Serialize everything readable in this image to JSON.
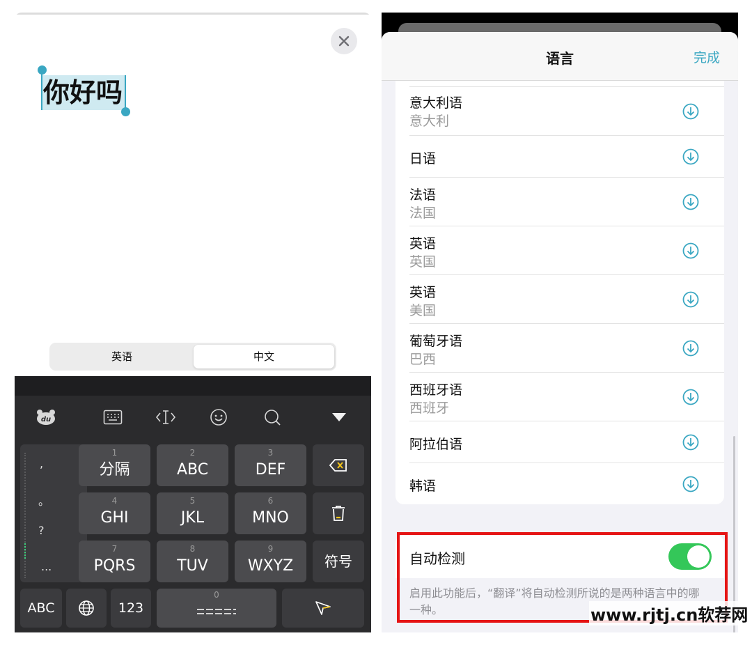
{
  "left": {
    "selected_text": "你好吗",
    "segment": {
      "left_label": "英语",
      "right_label": "中文",
      "active": "中文"
    },
    "keyboard": {
      "toolbar_icons": [
        "du-bear-logo-icon",
        "keyboard-icon",
        "cursor-icon",
        "emoji-icon",
        "search-icon",
        "collapse-icon"
      ],
      "punct": [
        ",",
        "。",
        "?",
        "..."
      ],
      "rows": [
        [
          {
            "num": "1",
            "label": "分隔"
          },
          {
            "num": "2",
            "label": "ABC"
          },
          {
            "num": "3",
            "label": "DEF"
          }
        ],
        [
          {
            "num": "4",
            "label": "GHI"
          },
          {
            "num": "5",
            "label": "JKL"
          },
          {
            "num": "6",
            "label": "MNO"
          }
        ],
        [
          {
            "num": "7",
            "label": "PQRS"
          },
          {
            "num": "8",
            "label": "TUV"
          },
          {
            "num": "9",
            "label": "WXYZ"
          }
        ]
      ],
      "symbol_key": "符号",
      "bottom": {
        "abc": "ABC",
        "num123": "123",
        "space_num": "0"
      }
    }
  },
  "right": {
    "title": "语言",
    "done": "完成",
    "languages": [
      {
        "name": "意大利语",
        "region": "意大利"
      },
      {
        "name": "日语",
        "region": ""
      },
      {
        "name": "法语",
        "region": "法国"
      },
      {
        "name": "英语",
        "region": "英国"
      },
      {
        "name": "英语",
        "region": "美国"
      },
      {
        "name": "葡萄牙语",
        "region": "巴西"
      },
      {
        "name": "西班牙语",
        "region": "西班牙"
      },
      {
        "name": "阿拉伯语",
        "region": ""
      },
      {
        "name": "韩语",
        "region": ""
      }
    ],
    "auto_detect": {
      "label": "自动检测",
      "enabled": true,
      "description": "启用此功能后，“翻译”将自动检测所说的是两种语言中的哪一种。"
    }
  },
  "watermark": "www.rjtj.cn软荐网",
  "colors": {
    "accent": "#3aa7c2",
    "toggle_on": "#34c759",
    "highlight": "#e51414"
  }
}
